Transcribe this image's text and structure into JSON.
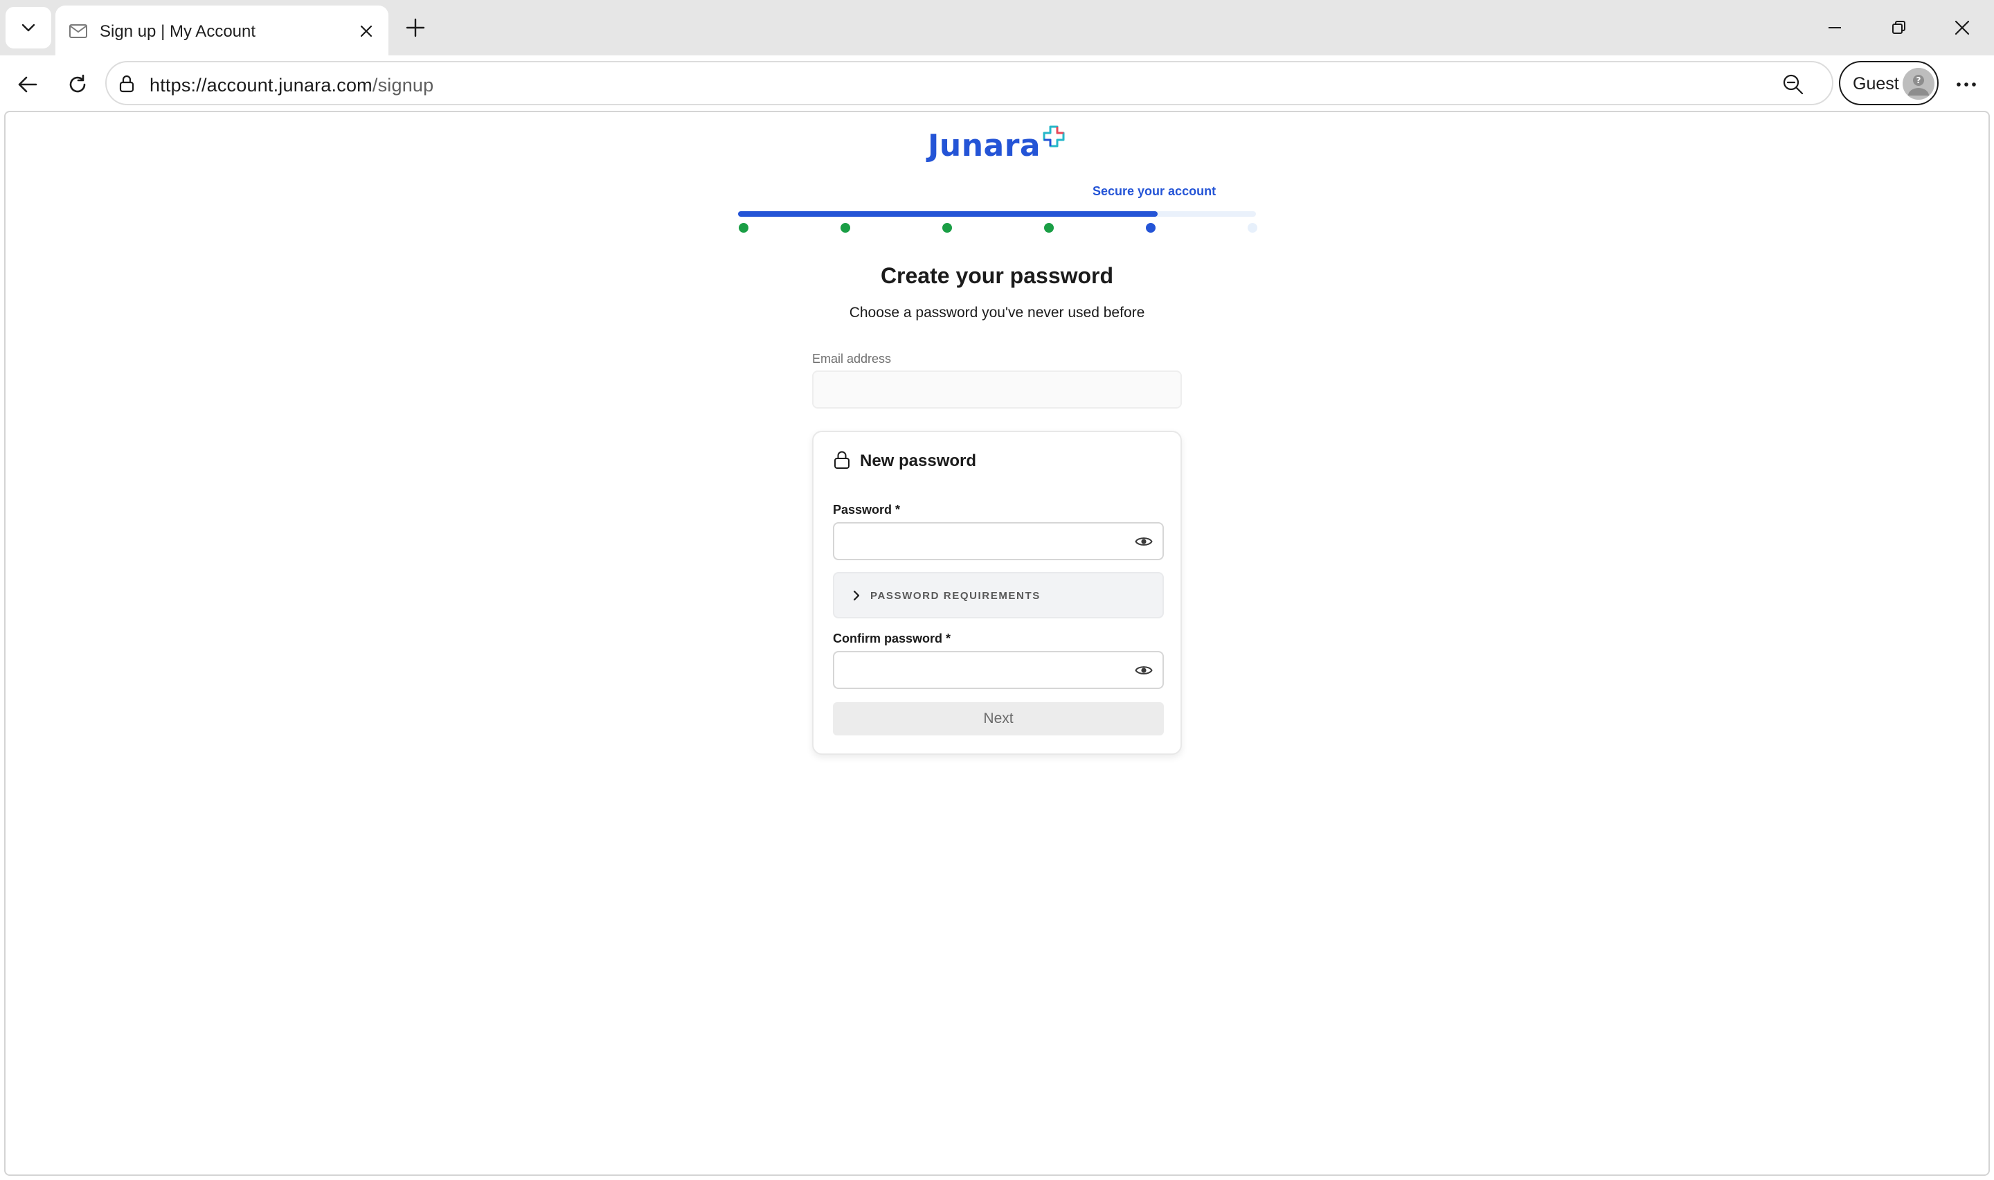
{
  "browser": {
    "tab": {
      "title": "Sign up | My Account",
      "favicon": "mail-icon"
    },
    "address_bar": {
      "url_host": "https://account.junara.com",
      "url_path": "/signup"
    },
    "profile": {
      "label": "Guest"
    }
  },
  "page": {
    "brand": {
      "name": "Junara"
    },
    "stepper": {
      "current_step_label": "Secure your account",
      "total_steps": 6,
      "current_step": 5,
      "progress_fraction": 0.81,
      "colors": {
        "complete": "#1a9e45",
        "current": "#2454d6",
        "upcoming": "#e7f0fb"
      }
    },
    "heading": "Create your password",
    "subheading": "Choose a password you've never used before",
    "email": {
      "label": "Email address",
      "value": ""
    },
    "card": {
      "title": "New password",
      "password_label": "Password *",
      "password_value": "",
      "requirements_label": "PASSWORD REQUIREMENTS",
      "confirm_label": "Confirm password *",
      "confirm_value": "",
      "next_label": "Next"
    },
    "accent_color": "#2454d6"
  }
}
